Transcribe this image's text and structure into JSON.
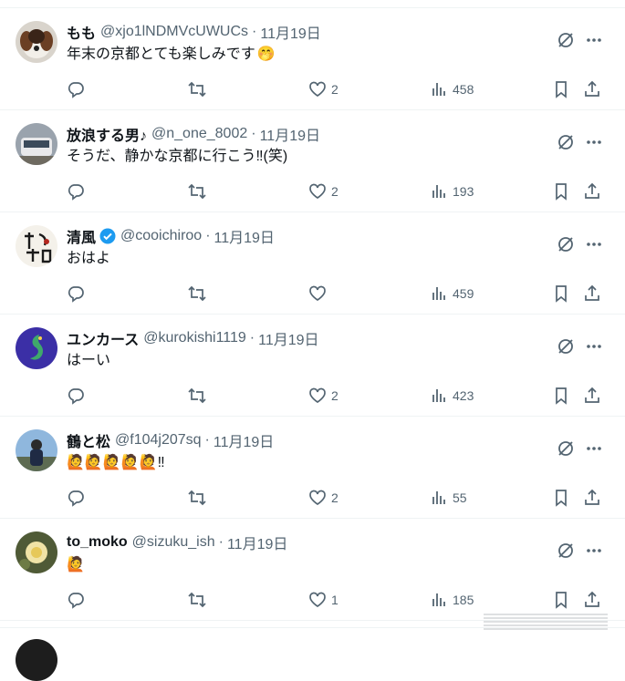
{
  "tweets": [
    {
      "name": "もも",
      "verified": false,
      "handle": "@xjo1lNDMVcUWUCs",
      "date": "11月19日",
      "text": "年末の京都とても楽しみです",
      "emoji": "🤭",
      "replies": "",
      "retweets": "",
      "likes": "2",
      "views": "458"
    },
    {
      "name": "放浪する男♪",
      "verified": false,
      "handle": "@n_one_8002",
      "date": "11月19日",
      "text": "そうだ、静かな京都に行こう‼(笑)",
      "emoji": "",
      "replies": "",
      "retweets": "",
      "likes": "2",
      "views": "193"
    },
    {
      "name": "清風",
      "verified": true,
      "handle": "@cooichiroo",
      "date": "11月19日",
      "text": "おはよ",
      "emoji": "",
      "replies": "",
      "retweets": "",
      "likes": "",
      "views": "459"
    },
    {
      "name": "ユンカース",
      "verified": false,
      "handle": "@kurokishi1119",
      "date": "11月19日",
      "text": "はーい",
      "emoji": "",
      "replies": "",
      "retweets": "",
      "likes": "2",
      "views": "423"
    },
    {
      "name": "鶴と松",
      "verified": false,
      "handle": "@f104j207sq",
      "date": "11月19日",
      "text": "",
      "emoji": "🙋🙋🙋🙋🙋‼",
      "replies": "",
      "retweets": "",
      "likes": "2",
      "views": "55"
    },
    {
      "name": "to_moko",
      "verified": false,
      "handle": "@sizuku_ish",
      "date": "11月19日",
      "text": "",
      "emoji": "🙋",
      "replies": "",
      "retweets": "",
      "likes": "1",
      "views": "185"
    }
  ],
  "separator": "·",
  "icons": [
    "grok-icon",
    "more-icon",
    "reply-icon",
    "retweet-icon",
    "like-icon",
    "views-icon",
    "bookmark-icon",
    "share-icon",
    "verified-badge-icon"
  ],
  "colors": {
    "text": "#0f1419",
    "muted": "#536471",
    "border": "#eff3f4",
    "verified": "#1d9bf0"
  }
}
